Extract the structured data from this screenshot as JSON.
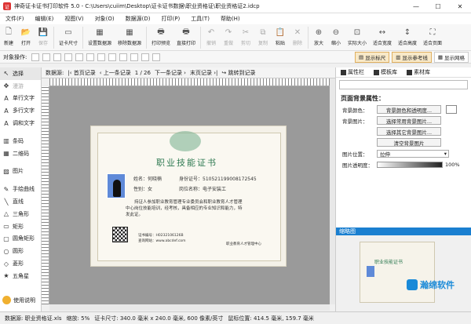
{
  "window": {
    "title": "神奇证卡证书打印软件 5.0 - C:\\Users\\cuiim\\Desktop\\证卡证书数据\\职业资格证\\职业资格证2.idcp"
  },
  "menu": [
    "文件(F)",
    "编辑(E)",
    "视图(V)",
    "对象(O)",
    "数据源(D)",
    "打印(P)",
    "工具(T)",
    "帮助(H)"
  ],
  "toolbar": [
    {
      "label": "新建",
      "icon": "new-icon",
      "enabled": true
    },
    {
      "label": "打开",
      "icon": "open-icon",
      "enabled": true
    },
    {
      "label": "保存",
      "icon": "save-icon",
      "enabled": false
    },
    {
      "label": "证卡尺寸",
      "icon": "card-size-icon",
      "enabled": true
    },
    {
      "label": "设置数据源",
      "icon": "set-datasource-icon",
      "enabled": true
    },
    {
      "label": "移除数据源",
      "icon": "remove-datasource-icon",
      "enabled": true
    },
    {
      "label": "打印预览",
      "icon": "print-preview-icon",
      "enabled": true
    },
    {
      "label": "直接打印",
      "icon": "print-icon",
      "enabled": true
    },
    {
      "label": "撤销",
      "icon": "undo-icon",
      "enabled": false
    },
    {
      "label": "重做",
      "icon": "redo-icon",
      "enabled": false
    },
    {
      "label": "剪切",
      "icon": "cut-icon",
      "enabled": false
    },
    {
      "label": "复制",
      "icon": "copy-icon",
      "enabled": false
    },
    {
      "label": "粘贴",
      "icon": "paste-icon",
      "enabled": true
    },
    {
      "label": "删除",
      "icon": "delete-icon",
      "enabled": false
    },
    {
      "label": "放大",
      "icon": "zoom-in-icon",
      "enabled": true
    },
    {
      "label": "缩小",
      "icon": "zoom-out-icon",
      "enabled": true
    },
    {
      "label": "实际大小",
      "icon": "actual-size-icon",
      "enabled": true
    },
    {
      "label": "适合宽度",
      "icon": "fit-width-icon",
      "enabled": true
    },
    {
      "label": "适合高度",
      "icon": "fit-height-icon",
      "enabled": true
    },
    {
      "label": "适合页面",
      "icon": "fit-page-icon",
      "enabled": true
    }
  ],
  "objbar": {
    "label": "对象操作:",
    "view_buttons": [
      "显示标尺",
      "显示参考线",
      "显示网格"
    ]
  },
  "tools": [
    {
      "label": "选择",
      "icon": "pointer-icon",
      "selected": true
    },
    {
      "label": "漫游",
      "icon": "pan-icon",
      "dim": true
    },
    {
      "label": "单行文字",
      "icon": "text-icon"
    },
    {
      "label": "多行文字",
      "icon": "multiline-text-icon"
    },
    {
      "label": "调和文字",
      "icon": "blend-text-icon"
    },
    {
      "label": "条码",
      "icon": "barcode-icon",
      "gap": true
    },
    {
      "label": "二维码",
      "icon": "qrcode-icon"
    },
    {
      "label": "图片",
      "icon": "image-icon",
      "gap": true
    },
    {
      "label": "手绘曲线",
      "icon": "freehand-icon",
      "gap": true
    },
    {
      "label": "直线",
      "icon": "line-icon"
    },
    {
      "label": "三角形",
      "icon": "triangle-icon"
    },
    {
      "label": "矩形",
      "icon": "rectangle-icon"
    },
    {
      "label": "圆角矩形",
      "icon": "rounded-rect-icon"
    },
    {
      "label": "圆形",
      "icon": "circle-icon"
    },
    {
      "label": "菱形",
      "icon": "diamond-icon"
    },
    {
      "label": "五角星",
      "icon": "star-icon"
    }
  ],
  "help": "使用说明",
  "databar": {
    "label": "数据源:",
    "first": "首页记录",
    "prev": "上一条记录",
    "page": "1 / 26",
    "next": "下一条记录",
    "last": "末页记录",
    "jump": "跳转到记录"
  },
  "certificate": {
    "title": "职业技能证书",
    "name": "姓名：何晓楠",
    "id": "身份证号：510521199008172545",
    "gender": "性别：女",
    "post": "岗位名称：电子安装工",
    "body1": "　　持证人参加职业教育管理专业委员会和职业教育人才管理",
    "body2": "中心岗位技能培训，经考核，具备相应的专业知识和能力，特",
    "body3": "发此证。",
    "cert_no": "证书编号：H0232106126B",
    "query": "查询网站：www.abcdef.com",
    "issuer": "职业教育人才管理中心"
  },
  "right": {
    "tabs": [
      "属性栏",
      "模板库",
      "素材库"
    ],
    "section": "页面背景属性：",
    "bg_color_label": "背景颜色：",
    "bg_color_btn": "背景颜色和透明度...",
    "bg_image_label": "背景图片：",
    "btn_common": "选择常用背景图片...",
    "btn_other": "选择其它背景图片...",
    "btn_clear": "清空背景图片",
    "pos_label": "图片位置：",
    "pos_value": "拉伸",
    "opacity_label": "图片透明度：",
    "opacity_value": "100%",
    "thumb_title": "缩略图"
  },
  "watermark": "瀚绵软件",
  "status": {
    "datasource": "数据源: 职业资格证.xls",
    "zoom": "缩放: 5%",
    "size": "证卡尺寸: 340.0 毫米 x 240.0 毫米, 600 像素/英寸",
    "coords": "鼠标位置: 414.5 毫米, 159.7 毫米"
  },
  "colors": {
    "accent": "#1a7fd0",
    "cert_green": "#2f7a52"
  }
}
